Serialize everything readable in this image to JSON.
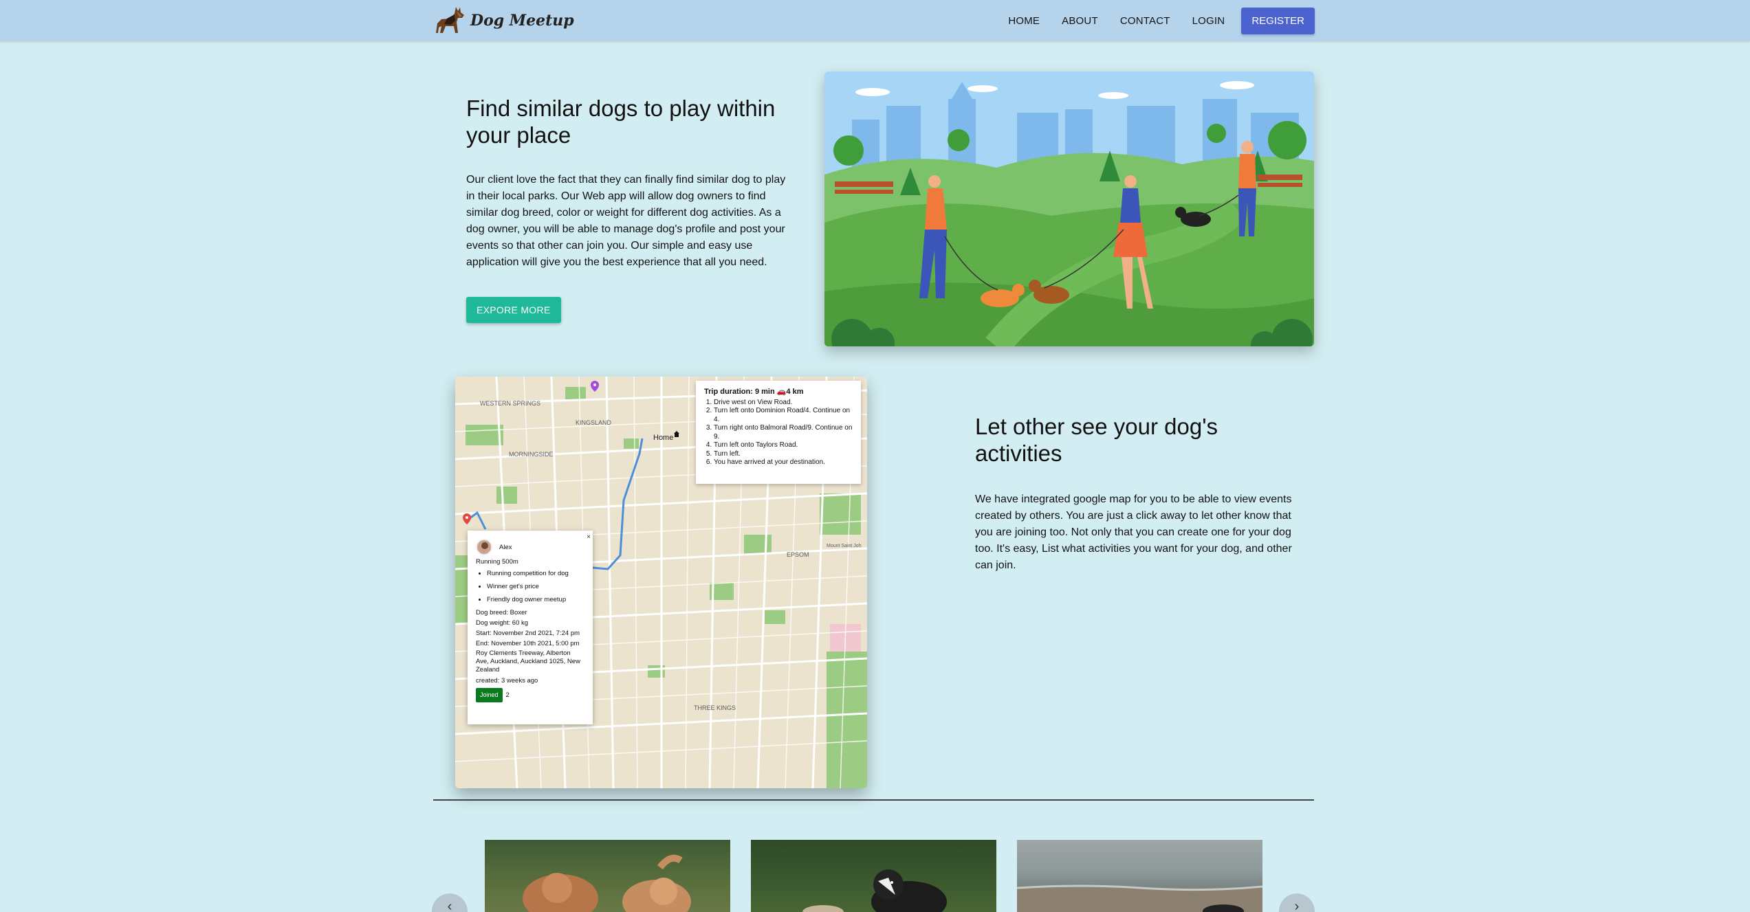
{
  "brand": {
    "name": "Dog Meetup",
    "logo_icon": "german-shepherd-logo"
  },
  "nav": {
    "items": [
      "HOME",
      "ABOUT",
      "CONTACT",
      "LOGIN"
    ],
    "register": "REGISTER"
  },
  "hero": {
    "title": "Find similar dogs to play within your place",
    "text": "Our client love the fact that they can finally find similar dog to play in their local parks. Our Web app will allow dog owners to find similar dog breed, color or weight for different dog activities. As a dog owner, you will be able to manage dog's profile and post your events so that other can join you. Our simple and easy use application will give you the best experience that all you need.",
    "button": "EXPORE MORE"
  },
  "map": {
    "labels": [
      "WESTERN SPRINGS",
      "KINGSLAND",
      "MORNINGSIDE",
      "Home",
      "EPSOM",
      "THREE KINGS",
      "Mount Saint Joh"
    ],
    "trip": {
      "title": "Trip duration: 9 min 🚗4 km",
      "steps": [
        "Drive west on View Road.",
        "Turn left onto Dominion Road/4. Continue on 4.",
        "Turn right onto Balmoral Road/9. Continue on 9.",
        "Turn left onto Taylors Road.",
        "Turn left.",
        "You have arrived at your destination."
      ]
    },
    "event": {
      "user": "Alex",
      "activity": "Running 500m",
      "items": [
        "Running competition for dog",
        "Winner get's price",
        "Friendly dog owner meetup"
      ],
      "breed": "Dog breed: Boxer",
      "weight": "Dog weight: 60 kg",
      "start": "Start: November 2nd 2021, 7:24 pm",
      "end": "End: November 10th 2021, 5:00 pm",
      "address": "Roy Clements Treeway, Alberton Ave, Auckland, Auckland 1025, New Zealand",
      "created": "created: 3 weeks ago",
      "joined_label": "Joined",
      "joined_count": "2",
      "close": "×"
    }
  },
  "section2": {
    "title": "Let other see your dog's activities",
    "text": "We have integrated google map for you to be able to view events created by others. You are just a click away to let other know that you are joining too. Not only that you can create one for your dog too. It's easy, List what activities you want for your dog, and other can join."
  },
  "carousel": {
    "prev": "‹",
    "next": "›"
  },
  "colors": {
    "navbar": "#b5d3eb",
    "background": "#d3eef3",
    "register": "#4c62cf",
    "explore": "#1fb99a",
    "joined": "#0b7a1f"
  }
}
